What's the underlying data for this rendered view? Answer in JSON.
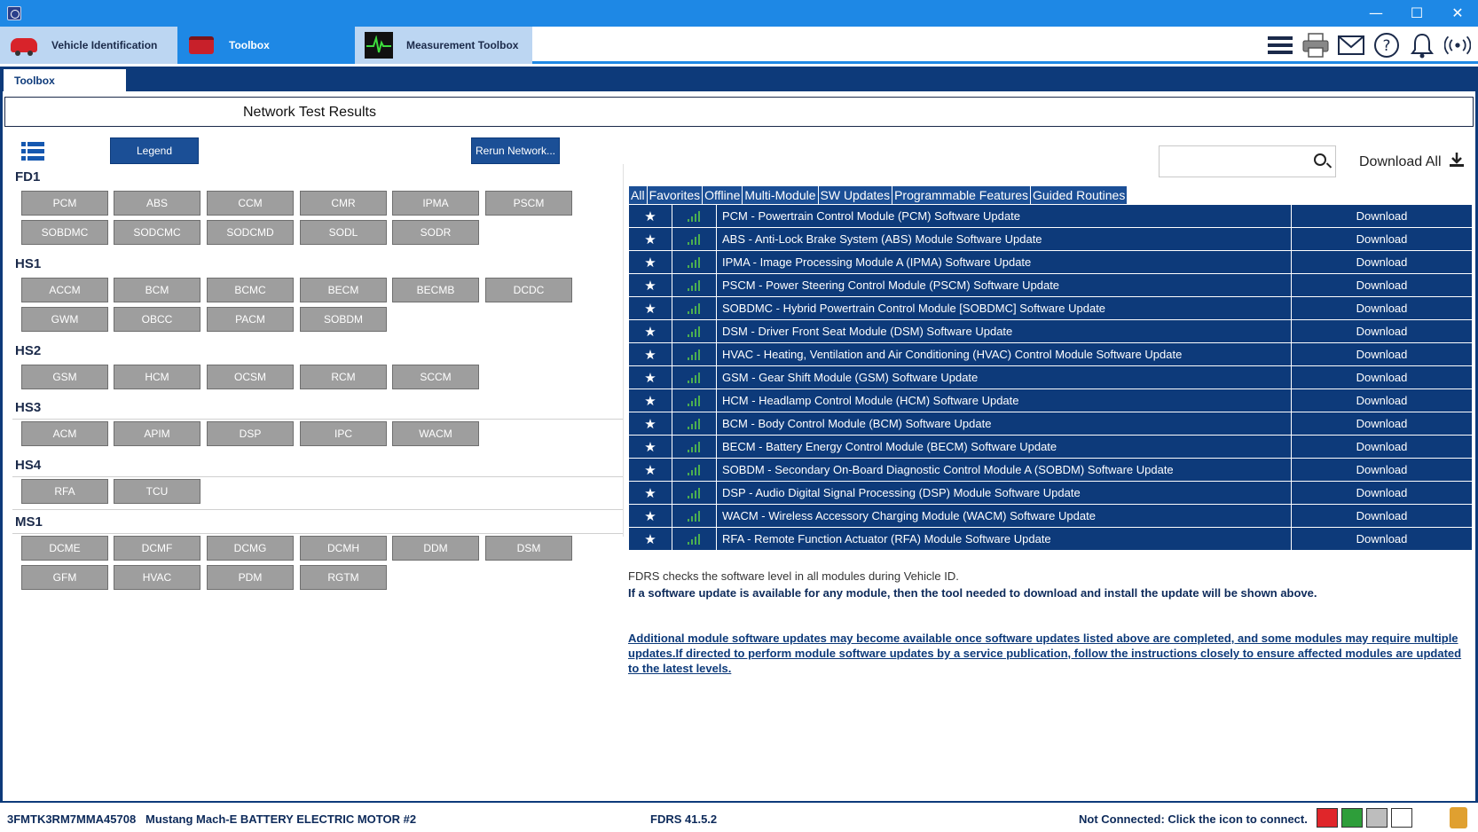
{
  "window": {
    "minimize": "—",
    "maximize": "☐",
    "close": "✕"
  },
  "nav": {
    "tabs": [
      {
        "label": "Vehicle Identification",
        "icon": "car-icon"
      },
      {
        "label": "Toolbox",
        "icon": "toolbox-icon"
      },
      {
        "label": "Measurement Toolbox",
        "icon": "oscilloscope-icon"
      }
    ],
    "tool_icons": [
      "menu-icon",
      "printer-icon",
      "mail-icon",
      "help-icon",
      "bell-icon",
      "connection-icon"
    ]
  },
  "subtab": "Toolbox",
  "page_title": "Network Test Results",
  "buttons": {
    "legend": "Legend",
    "rerun": "Rerun Network..."
  },
  "networks": [
    {
      "name": "FD1",
      "modules": [
        "PCM",
        "ABS",
        "CCM",
        "CMR",
        "IPMA",
        "PSCM",
        "SOBDMC",
        "SODCMC",
        "SODCMD",
        "SODL",
        "SODR"
      ]
    },
    {
      "name": "HS1",
      "modules": [
        "ACCM",
        "BCM",
        "BCMC",
        "BECM",
        "BECMB",
        "DCDC",
        "GWM",
        "OBCC",
        "PACM",
        "SOBDM"
      ]
    },
    {
      "name": "HS2",
      "modules": [
        "GSM",
        "HCM",
        "OCSM",
        "RCM",
        "SCCM"
      ]
    },
    {
      "name": "HS3",
      "modules": [
        "ACM",
        "APIM",
        "DSP",
        "IPC",
        "WACM"
      ]
    },
    {
      "name": "HS4",
      "modules": [
        "RFA",
        "TCU"
      ]
    },
    {
      "name": "MS1",
      "modules": [
        "DCME",
        "DCMF",
        "DCMG",
        "DCMH",
        "DDM",
        "DSM",
        "GFM",
        "HVAC",
        "PDM",
        "RGTM"
      ]
    }
  ],
  "search": {
    "placeholder": ""
  },
  "download_all": "Download All",
  "filter_tabs": [
    "All",
    "Favorites",
    "Offline",
    "Multi-Module",
    "SW Updates",
    "Programmable Features",
    "Guided Routines"
  ],
  "updates": [
    {
      "name": "PCM - Powertrain Control Module (PCM) Software Update",
      "action": "Download"
    },
    {
      "name": "ABS - Anti-Lock Brake System (ABS) Module Software Update",
      "action": "Download"
    },
    {
      "name": "IPMA - Image Processing Module A (IPMA) Software Update",
      "action": "Download"
    },
    {
      "name": "PSCM - Power Steering Control Module (PSCM) Software Update",
      "action": "Download"
    },
    {
      "name": "SOBDMC - Hybrid Powertrain Control Module [SOBDMC] Software Update",
      "action": "Download"
    },
    {
      "name": "DSM - Driver Front Seat Module (DSM) Software Update",
      "action": "Download"
    },
    {
      "name": "HVAC - Heating, Ventilation and Air Conditioning (HVAC) Control Module Software Update",
      "action": "Download"
    },
    {
      "name": "GSM - Gear Shift Module (GSM) Software Update",
      "action": "Download"
    },
    {
      "name": "HCM - Headlamp Control Module (HCM) Software Update",
      "action": "Download"
    },
    {
      "name": "BCM - Body Control Module (BCM) Software Update",
      "action": "Download"
    },
    {
      "name": "BECM - Battery Energy Control Module (BECM) Software Update",
      "action": "Download"
    },
    {
      "name": "SOBDM - Secondary On-Board Diagnostic Control Module A (SOBDM) Software Update",
      "action": "Download"
    },
    {
      "name": "DSP - Audio Digital Signal Processing (DSP) Module Software Update",
      "action": "Download"
    },
    {
      "name": "WACM - Wireless Accessory Charging Module (WACM) Software Update",
      "action": "Download"
    },
    {
      "name": "RFA - Remote Function Actuator (RFA) Module Software Update",
      "action": "Download"
    }
  ],
  "info": {
    "line1": "FDRS checks the software level in all modules during Vehicle ID.",
    "line2": "If a software update is available for any module, then the tool needed to download and install the update will be shown above.",
    "line3": "Additional module software updates may become available once software updates listed above are completed, and some modules may require multiple updates.If directed to perform module software updates by a service publication, follow the instructions closely to ensure affected modules are updated to the latest levels."
  },
  "status": {
    "vin": "3FMTK3RM7MMA45708",
    "vehicle": "Mustang Mach-E BATTERY ELECTRIC MOTOR #2",
    "version": "FDRS 41.5.2",
    "connection": "Not Connected: Click the icon to connect."
  },
  "colors": {
    "brand_blue": "#1e88e5",
    "navy": "#0d3a7a",
    "module_gray": "#9e9e9e",
    "signal_green": "#4caf50"
  }
}
